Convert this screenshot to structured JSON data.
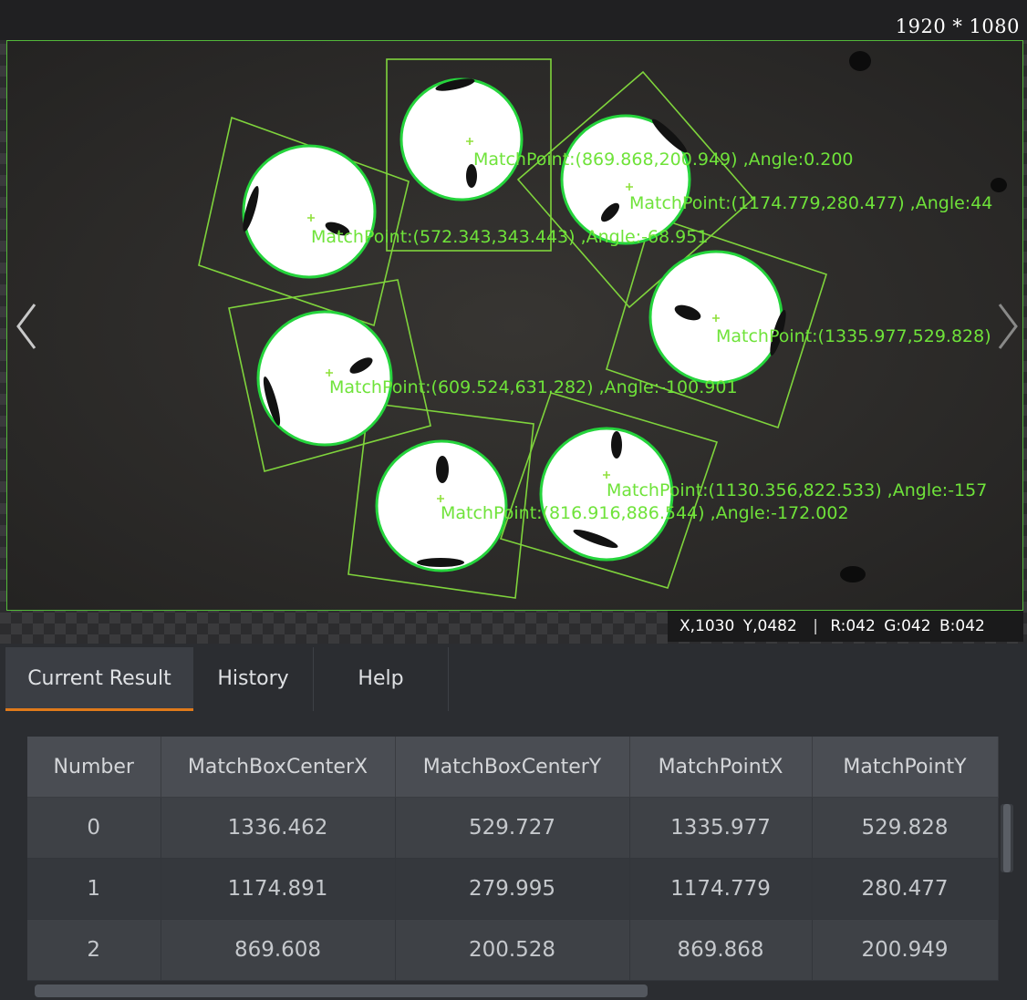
{
  "viewer": {
    "resolution": "1920 * 1080",
    "annotations": [
      "MatchPoint:(869.868,200.949) ,Angle:0.200",
      "MatchPoint:(1174.779,280.477) ,Angle:44",
      "MatchPoint:(572.343,343.443) ,Angle:-68.951",
      "MatchPoint:(1335.977,529.828)",
      "MatchPoint:(609.524,631.282) ,Angle:-100.901",
      "MatchPoint:(1130.356,822.533) ,Angle:-157",
      "MatchPoint:(816.916,886.544) ,Angle:-172.002"
    ],
    "pixel_readout": {
      "x": "X,1030",
      "y": "Y,0482",
      "separator": "|",
      "r": "R:042",
      "g": "G:042",
      "b": "B:042"
    },
    "icons": {
      "prev": "chevron-left-icon",
      "next": "chevron-right-icon"
    }
  },
  "tabs": [
    {
      "label": "Current Result",
      "active": true
    },
    {
      "label": "History",
      "active": false
    },
    {
      "label": "Help",
      "active": false
    }
  ],
  "table": {
    "headers": [
      "Number",
      "MatchBoxCenterX",
      "MatchBoxCenterY",
      "MatchPointX",
      "MatchPointY"
    ],
    "rows": [
      [
        "0",
        "1336.462",
        "529.727",
        "1335.977",
        "529.828"
      ],
      [
        "1",
        "1174.891",
        "279.995",
        "1174.779",
        "280.477"
      ],
      [
        "2",
        "869.608",
        "200.528",
        "869.868",
        "200.949"
      ]
    ]
  },
  "colors": {
    "match_green": "#53d23a",
    "tab_accent": "#e07a1a",
    "panel_bg": "#2b2d31"
  }
}
